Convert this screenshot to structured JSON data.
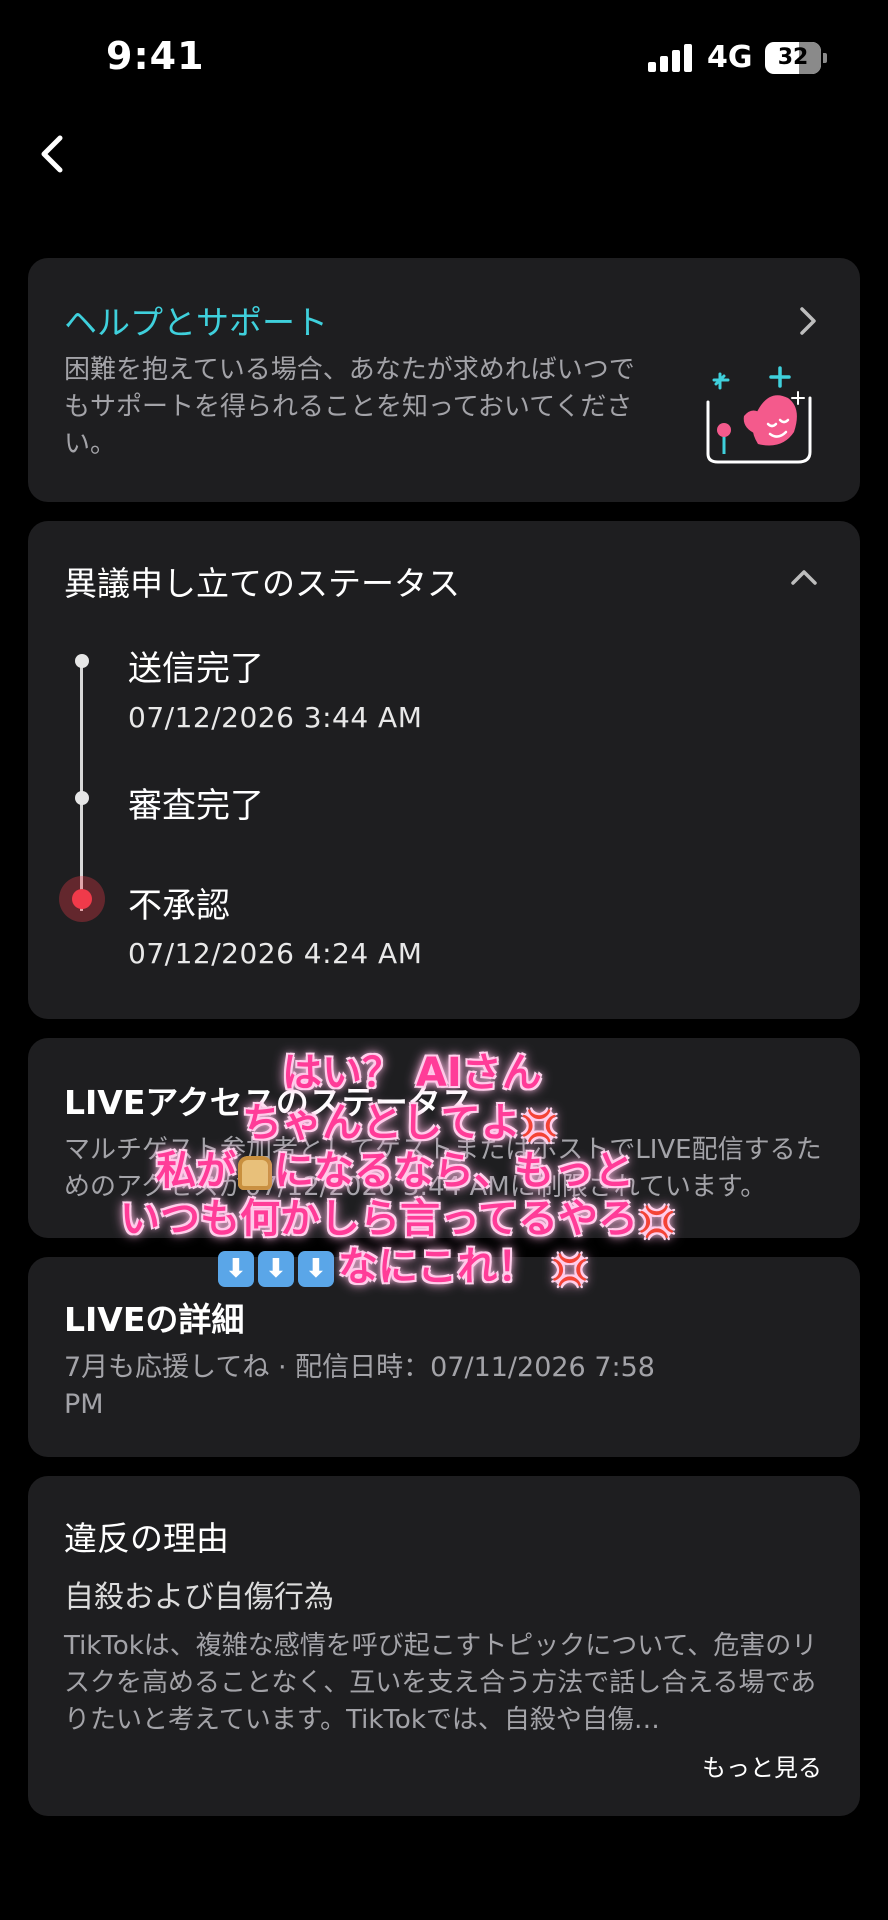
{
  "status_bar": {
    "time": "9:41",
    "network": "4G",
    "battery": "32"
  },
  "help": {
    "title": "ヘルプとサポート",
    "description": "困難を抱えている場合、あなたが求めればいつでもサポートを得られることを知っておいてください。"
  },
  "appeal_status": {
    "title": "異議申し立てのステータス",
    "steps": [
      {
        "label": "送信完了",
        "time": "07/12/2026 3:44 AM"
      },
      {
        "label": "審査完了",
        "time": ""
      },
      {
        "label": "不承認",
        "time": "07/12/2026 4:24 AM"
      }
    ]
  },
  "live_access": {
    "title": "LIVEアクセスのステータス",
    "description": "マルチゲスト参加者としてゲストまたはホストでLIVE配信するためのアクセスが07/12/2026 3:44 AMに制限されています。"
  },
  "live_details": {
    "title": "LIVEの詳細",
    "description": "7月も応援してね · 配信日時：07/11/2026 7:58 PM"
  },
  "reason": {
    "title": "違反の理由",
    "subtitle": "自殺および自傷行為",
    "description": "TikTokは、複雑な感情を呼び起こすトピックについて、危害のリスクを高めることなく、互いを支え合う方法で話し合える場でありたいと考えています。TikTokでは、自殺や自傷…",
    "more_label": "もっと見る"
  },
  "overlay": {
    "line1": "はい？ AIさん",
    "line2": "ちゃんとしてよ",
    "line3a": "私が",
    "line3b": "になるなら、もっと",
    "line4": "いつも何かしら言ってるやろ",
    "line5": "なにこれ！"
  },
  "colors": {
    "accent": "#3fd0dc",
    "reject": "#f03a4a",
    "card": "#1e1e20",
    "overlay_text": "#ff3c98"
  }
}
